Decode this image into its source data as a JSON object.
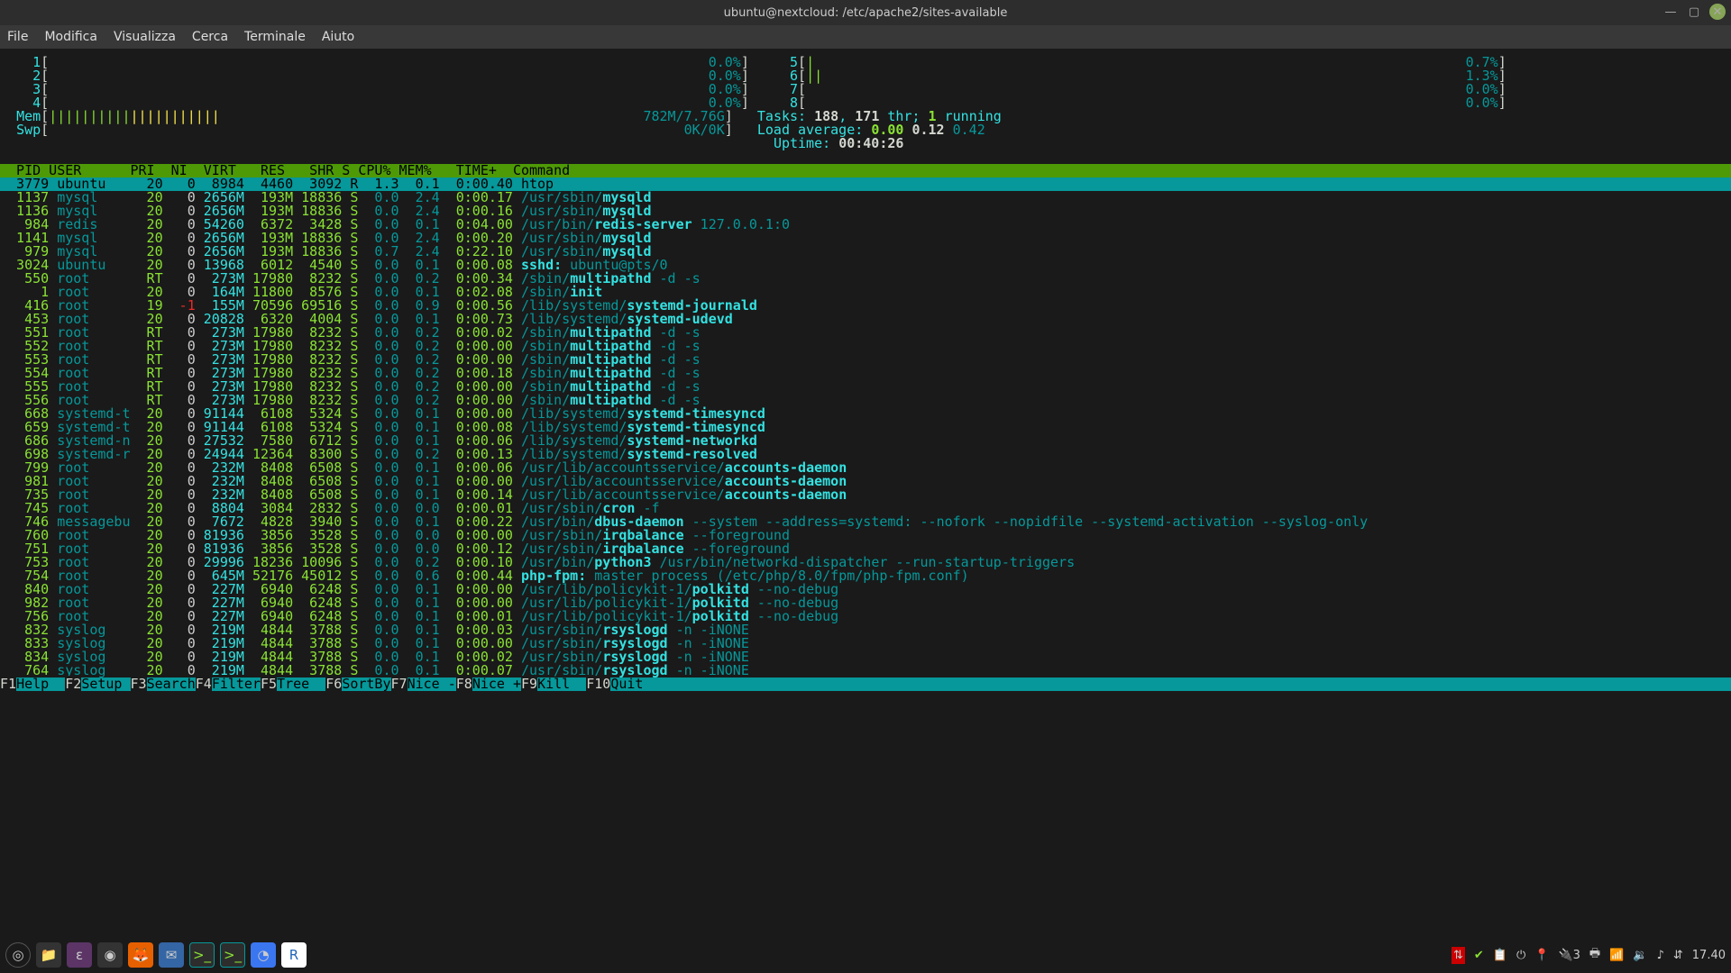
{
  "window": {
    "title": "ubuntu@nextcloud: /etc/apache2/sites-available"
  },
  "menubar": [
    "File",
    "Modifica",
    "Visualizza",
    "Cerca",
    "Terminale",
    "Aiuto"
  ],
  "meters": {
    "left": [
      {
        "n": "1",
        "bar": "",
        "pct": "0.0%"
      },
      {
        "n": "2",
        "bar": "",
        "pct": "0.0%"
      },
      {
        "n": "3",
        "bar": "",
        "pct": "0.0%"
      },
      {
        "n": "4",
        "bar": "",
        "pct": "0.0%"
      },
      {
        "n": "Mem",
        "bar": "|||||||||||||||||||||",
        "pct": "782M/7.76G"
      },
      {
        "n": "Swp",
        "bar": "",
        "pct": "0K/0K"
      }
    ],
    "right": [
      {
        "n": "5",
        "bar": "|",
        "pct": "0.7%"
      },
      {
        "n": "6",
        "bar": "||",
        "pct": "1.3%"
      },
      {
        "n": "7",
        "bar": "",
        "pct": "0.0%"
      },
      {
        "n": "8",
        "bar": "",
        "pct": "0.0%"
      }
    ],
    "tasks_label": "Tasks: ",
    "tasks": "188",
    "tasks_sep": ", ",
    "thr": "171",
    "thr_lbl": " thr; ",
    "run": "1",
    "run_lbl": " running",
    "load_label": "Load average: ",
    "l1": "0.00",
    "l2": "0.12",
    "l3": "0.42",
    "uptime_label": "Uptime: ",
    "uptime": "00:40:26"
  },
  "header": "  PID USER      PRI  NI  VIRT   RES   SHR S CPU% MEM%   TIME+  Command",
  "selected": {
    "pid": "3779",
    "user": "ubuntu",
    "pri": "20",
    "ni": "0",
    "virt": "8984",
    "res": "4460",
    "shr": "3092",
    "s": "R",
    "cpu": "1.3",
    "mem": "0.1",
    "time": "0:00.40",
    "cmd": "htop"
  },
  "processes": [
    {
      "pid": "1137",
      "user": "mysql",
      "pri": "20",
      "ni": "0",
      "virt": "2656M",
      "res": "193M",
      "shr": "18836",
      "s": "S",
      "cpu": "0.0",
      "mem": "2.4",
      "time": "0:00.17",
      "cmd": "/usr/sbin/mysqld"
    },
    {
      "pid": "1136",
      "user": "mysql",
      "pri": "20",
      "ni": "0",
      "virt": "2656M",
      "res": "193M",
      "shr": "18836",
      "s": "S",
      "cpu": "0.0",
      "mem": "2.4",
      "time": "0:00.16",
      "cmd": "/usr/sbin/mysqld"
    },
    {
      "pid": "984",
      "user": "redis",
      "pri": "20",
      "ni": "0",
      "virt": "54260",
      "res": "6372",
      "shr": "3428",
      "s": "S",
      "cpu": "0.0",
      "mem": "0.1",
      "time": "0:04.00",
      "cmd": "/usr/bin/redis-server 127.0.0.1:0"
    },
    {
      "pid": "1141",
      "user": "mysql",
      "pri": "20",
      "ni": "0",
      "virt": "2656M",
      "res": "193M",
      "shr": "18836",
      "s": "S",
      "cpu": "0.0",
      "mem": "2.4",
      "time": "0:00.20",
      "cmd": "/usr/sbin/mysqld"
    },
    {
      "pid": "979",
      "user": "mysql",
      "pri": "20",
      "ni": "0",
      "virt": "2656M",
      "res": "193M",
      "shr": "18836",
      "s": "S",
      "cpu": "0.7",
      "mem": "2.4",
      "time": "0:22.10",
      "cmd": "/usr/sbin/mysqld"
    },
    {
      "pid": "3024",
      "user": "ubuntu",
      "pri": "20",
      "ni": "0",
      "virt": "13968",
      "res": "6012",
      "shr": "4540",
      "s": "S",
      "cpu": "0.0",
      "mem": "0.1",
      "time": "0:00.08",
      "cmd": "sshd: ubuntu@pts/0"
    },
    {
      "pid": "550",
      "user": "root",
      "pri": "RT",
      "ni": "0",
      "virt": "273M",
      "res": "17980",
      "shr": "8232",
      "s": "S",
      "cpu": "0.0",
      "mem": "0.2",
      "time": "0:00.34",
      "cmd": "/sbin/multipathd -d -s"
    },
    {
      "pid": "1",
      "user": "root",
      "pri": "20",
      "ni": "0",
      "virt": "164M",
      "res": "11800",
      "shr": "8576",
      "s": "S",
      "cpu": "0.0",
      "mem": "0.1",
      "time": "0:02.08",
      "cmd": "/sbin/init"
    },
    {
      "pid": "416",
      "user": "root",
      "pri": "19",
      "ni": "-1",
      "virt": "155M",
      "res": "70596",
      "shr": "69516",
      "s": "S",
      "cpu": "0.0",
      "mem": "0.9",
      "time": "0:00.56",
      "cmd": "/lib/systemd/systemd-journald"
    },
    {
      "pid": "453",
      "user": "root",
      "pri": "20",
      "ni": "0",
      "virt": "20828",
      "res": "6320",
      "shr": "4004",
      "s": "S",
      "cpu": "0.0",
      "mem": "0.1",
      "time": "0:00.73",
      "cmd": "/lib/systemd/systemd-udevd"
    },
    {
      "pid": "551",
      "user": "root",
      "pri": "RT",
      "ni": "0",
      "virt": "273M",
      "res": "17980",
      "shr": "8232",
      "s": "S",
      "cpu": "0.0",
      "mem": "0.2",
      "time": "0:00.02",
      "cmd": "/sbin/multipathd -d -s"
    },
    {
      "pid": "552",
      "user": "root",
      "pri": "RT",
      "ni": "0",
      "virt": "273M",
      "res": "17980",
      "shr": "8232",
      "s": "S",
      "cpu": "0.0",
      "mem": "0.2",
      "time": "0:00.00",
      "cmd": "/sbin/multipathd -d -s"
    },
    {
      "pid": "553",
      "user": "root",
      "pri": "RT",
      "ni": "0",
      "virt": "273M",
      "res": "17980",
      "shr": "8232",
      "s": "S",
      "cpu": "0.0",
      "mem": "0.2",
      "time": "0:00.00",
      "cmd": "/sbin/multipathd -d -s"
    },
    {
      "pid": "554",
      "user": "root",
      "pri": "RT",
      "ni": "0",
      "virt": "273M",
      "res": "17980",
      "shr": "8232",
      "s": "S",
      "cpu": "0.0",
      "mem": "0.2",
      "time": "0:00.18",
      "cmd": "/sbin/multipathd -d -s"
    },
    {
      "pid": "555",
      "user": "root",
      "pri": "RT",
      "ni": "0",
      "virt": "273M",
      "res": "17980",
      "shr": "8232",
      "s": "S",
      "cpu": "0.0",
      "mem": "0.2",
      "time": "0:00.00",
      "cmd": "/sbin/multipathd -d -s"
    },
    {
      "pid": "556",
      "user": "root",
      "pri": "RT",
      "ni": "0",
      "virt": "273M",
      "res": "17980",
      "shr": "8232",
      "s": "S",
      "cpu": "0.0",
      "mem": "0.2",
      "time": "0:00.00",
      "cmd": "/sbin/multipathd -d -s"
    },
    {
      "pid": "668",
      "user": "systemd-t",
      "pri": "20",
      "ni": "0",
      "virt": "91144",
      "res": "6108",
      "shr": "5324",
      "s": "S",
      "cpu": "0.0",
      "mem": "0.1",
      "time": "0:00.00",
      "cmd": "/lib/systemd/systemd-timesyncd"
    },
    {
      "pid": "659",
      "user": "systemd-t",
      "pri": "20",
      "ni": "0",
      "virt": "91144",
      "res": "6108",
      "shr": "5324",
      "s": "S",
      "cpu": "0.0",
      "mem": "0.1",
      "time": "0:00.08",
      "cmd": "/lib/systemd/systemd-timesyncd"
    },
    {
      "pid": "686",
      "user": "systemd-n",
      "pri": "20",
      "ni": "0",
      "virt": "27532",
      "res": "7580",
      "shr": "6712",
      "s": "S",
      "cpu": "0.0",
      "mem": "0.1",
      "time": "0:00.06",
      "cmd": "/lib/systemd/systemd-networkd"
    },
    {
      "pid": "698",
      "user": "systemd-r",
      "pri": "20",
      "ni": "0",
      "virt": "24944",
      "res": "12364",
      "shr": "8300",
      "s": "S",
      "cpu": "0.0",
      "mem": "0.2",
      "time": "0:00.13",
      "cmd": "/lib/systemd/systemd-resolved"
    },
    {
      "pid": "799",
      "user": "root",
      "pri": "20",
      "ni": "0",
      "virt": "232M",
      "res": "8408",
      "shr": "6508",
      "s": "S",
      "cpu": "0.0",
      "mem": "0.1",
      "time": "0:00.06",
      "cmd": "/usr/lib/accountsservice/accounts-daemon"
    },
    {
      "pid": "981",
      "user": "root",
      "pri": "20",
      "ni": "0",
      "virt": "232M",
      "res": "8408",
      "shr": "6508",
      "s": "S",
      "cpu": "0.0",
      "mem": "0.1",
      "time": "0:00.00",
      "cmd": "/usr/lib/accountsservice/accounts-daemon"
    },
    {
      "pid": "735",
      "user": "root",
      "pri": "20",
      "ni": "0",
      "virt": "232M",
      "res": "8408",
      "shr": "6508",
      "s": "S",
      "cpu": "0.0",
      "mem": "0.1",
      "time": "0:00.14",
      "cmd": "/usr/lib/accountsservice/accounts-daemon"
    },
    {
      "pid": "745",
      "user": "root",
      "pri": "20",
      "ni": "0",
      "virt": "8804",
      "res": "3084",
      "shr": "2832",
      "s": "S",
      "cpu": "0.0",
      "mem": "0.0",
      "time": "0:00.01",
      "cmd": "/usr/sbin/cron -f"
    },
    {
      "pid": "746",
      "user": "messagebu",
      "pri": "20",
      "ni": "0",
      "virt": "7672",
      "res": "4828",
      "shr": "3940",
      "s": "S",
      "cpu": "0.0",
      "mem": "0.1",
      "time": "0:00.22",
      "cmd": "/usr/bin/dbus-daemon --system --address=systemd: --nofork --nopidfile --systemd-activation --syslog-only"
    },
    {
      "pid": "760",
      "user": "root",
      "pri": "20",
      "ni": "0",
      "virt": "81936",
      "res": "3856",
      "shr": "3528",
      "s": "S",
      "cpu": "0.0",
      "mem": "0.0",
      "time": "0:00.00",
      "cmd": "/usr/sbin/irqbalance --foreground"
    },
    {
      "pid": "751",
      "user": "root",
      "pri": "20",
      "ni": "0",
      "virt": "81936",
      "res": "3856",
      "shr": "3528",
      "s": "S",
      "cpu": "0.0",
      "mem": "0.0",
      "time": "0:00.12",
      "cmd": "/usr/sbin/irqbalance --foreground"
    },
    {
      "pid": "753",
      "user": "root",
      "pri": "20",
      "ni": "0",
      "virt": "29996",
      "res": "18236",
      "shr": "10096",
      "s": "S",
      "cpu": "0.0",
      "mem": "0.2",
      "time": "0:00.10",
      "cmd": "/usr/bin/python3 /usr/bin/networkd-dispatcher --run-startup-triggers"
    },
    {
      "pid": "754",
      "user": "root",
      "pri": "20",
      "ni": "0",
      "virt": "645M",
      "res": "52176",
      "shr": "45012",
      "s": "S",
      "cpu": "0.0",
      "mem": "0.6",
      "time": "0:00.44",
      "cmd": "php-fpm: master process (/etc/php/8.0/fpm/php-fpm.conf)"
    },
    {
      "pid": "840",
      "user": "root",
      "pri": "20",
      "ni": "0",
      "virt": "227M",
      "res": "6940",
      "shr": "6248",
      "s": "S",
      "cpu": "0.0",
      "mem": "0.1",
      "time": "0:00.00",
      "cmd": "/usr/lib/policykit-1/polkitd --no-debug"
    },
    {
      "pid": "982",
      "user": "root",
      "pri": "20",
      "ni": "0",
      "virt": "227M",
      "res": "6940",
      "shr": "6248",
      "s": "S",
      "cpu": "0.0",
      "mem": "0.1",
      "time": "0:00.00",
      "cmd": "/usr/lib/policykit-1/polkitd --no-debug"
    },
    {
      "pid": "756",
      "user": "root",
      "pri": "20",
      "ni": "0",
      "virt": "227M",
      "res": "6940",
      "shr": "6248",
      "s": "S",
      "cpu": "0.0",
      "mem": "0.1",
      "time": "0:00.01",
      "cmd": "/usr/lib/policykit-1/polkitd --no-debug"
    },
    {
      "pid": "832",
      "user": "syslog",
      "pri": "20",
      "ni": "0",
      "virt": "219M",
      "res": "4844",
      "shr": "3788",
      "s": "S",
      "cpu": "0.0",
      "mem": "0.1",
      "time": "0:00.03",
      "cmd": "/usr/sbin/rsyslogd -n -iNONE"
    },
    {
      "pid": "833",
      "user": "syslog",
      "pri": "20",
      "ni": "0",
      "virt": "219M",
      "res": "4844",
      "shr": "3788",
      "s": "S",
      "cpu": "0.0",
      "mem": "0.1",
      "time": "0:00.00",
      "cmd": "/usr/sbin/rsyslogd -n -iNONE"
    },
    {
      "pid": "834",
      "user": "syslog",
      "pri": "20",
      "ni": "0",
      "virt": "219M",
      "res": "4844",
      "shr": "3788",
      "s": "S",
      "cpu": "0.0",
      "mem": "0.1",
      "time": "0:00.02",
      "cmd": "/usr/sbin/rsyslogd -n -iNONE"
    },
    {
      "pid": "764",
      "user": "syslog",
      "pri": "20",
      "ni": "0",
      "virt": "219M",
      "res": "4844",
      "shr": "3788",
      "s": "S",
      "cpu": "0.0",
      "mem": "0.1",
      "time": "0:00.07",
      "cmd": "/usr/sbin/rsyslogd -n -iNONE"
    }
  ],
  "fkeys": [
    {
      "k": "F1",
      "l": "Help  "
    },
    {
      "k": "F2",
      "l": "Setup "
    },
    {
      "k": "F3",
      "l": "Search"
    },
    {
      "k": "F4",
      "l": "Filter"
    },
    {
      "k": "F5",
      "l": "Tree  "
    },
    {
      "k": "F6",
      "l": "SortBy"
    },
    {
      "k": "F7",
      "l": "Nice -"
    },
    {
      "k": "F8",
      "l": "Nice +"
    },
    {
      "k": "F9",
      "l": "Kill  "
    },
    {
      "k": "F10",
      "l": "Quit  "
    }
  ],
  "taskbar": {
    "clock": "17.40",
    "tray": [
      "🔴",
      "✔",
      "📋",
      "⏻",
      "📍",
      "🔌",
      "3",
      "📠",
      "🛡",
      "🔗",
      "🎵",
      "🌐"
    ]
  }
}
